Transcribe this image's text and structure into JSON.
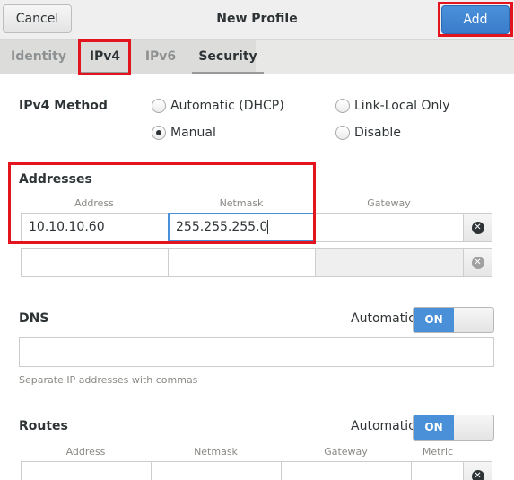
{
  "header": {
    "cancel_label": "Cancel",
    "title": "New Profile",
    "add_label": "Add"
  },
  "tabs": [
    {
      "label": "Identity",
      "active": false
    },
    {
      "label": "IPv4",
      "active": true
    },
    {
      "label": "IPv6",
      "active": false
    },
    {
      "label": "Security",
      "active": false
    }
  ],
  "ipv4_method": {
    "label": "IPv4 Method",
    "options": [
      {
        "label": "Automatic (DHCP)",
        "selected": false
      },
      {
        "label": "Link-Local Only",
        "selected": false
      },
      {
        "label": "Manual",
        "selected": true
      },
      {
        "label": "Disable",
        "selected": false
      }
    ]
  },
  "addresses": {
    "label": "Addresses",
    "columns": {
      "address": "Address",
      "netmask": "Netmask",
      "gateway": "Gateway"
    },
    "rows": [
      {
        "address": "10.10.10.60",
        "netmask": "255.255.255.0",
        "gateway": ""
      },
      {
        "address": "",
        "netmask": "",
        "gateway": ""
      }
    ]
  },
  "dns": {
    "label": "DNS",
    "automatic_label": "Automatic",
    "switch_label": "ON",
    "switch_on": true,
    "value": "",
    "hint": "Separate IP addresses with commas"
  },
  "routes": {
    "label": "Routes",
    "automatic_label": "Automatic",
    "switch_label": "ON",
    "switch_on": true,
    "columns": {
      "address": "Address",
      "netmask": "Netmask",
      "gateway": "Gateway",
      "metric": "Metric"
    }
  },
  "colors": {
    "accent": "#4a90d9",
    "highlight": "#e3141d"
  }
}
